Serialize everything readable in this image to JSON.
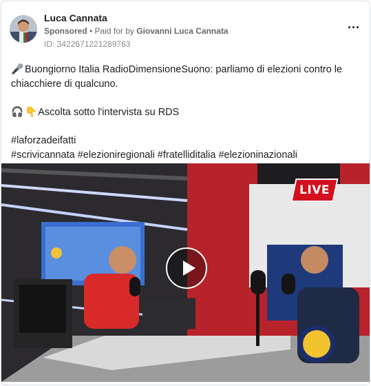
{
  "post": {
    "author": "Luca Cannata",
    "sponsored_label": "Sponsored",
    "separator": " • ",
    "paid_for_prefix": "Paid for by ",
    "paid_for_name": "Giovanni Luca Cannata",
    "ad_id": "ID: 3422671221289763",
    "lines": {
      "line1": "Buongiorno Italia RadioDimensioneSuono: parliamo di elezioni contro le chiacchiere di qualcuno.",
      "line2": "Ascolta sotto l'intervista su RDS",
      "hashtag1": "#laforzadeifatti",
      "hashtags2": "#scrivicannata #elezioniregionali #fratelliditalia #elezioninazionali"
    },
    "emojis": {
      "microphone": "🎤",
      "headphones": "🎧",
      "point_down": "👇"
    }
  },
  "video": {
    "live_badge": "LIVE",
    "play_icon": "play-icon"
  },
  "colors": {
    "live_red": "#d2101e",
    "meta_gray": "#65676b"
  }
}
